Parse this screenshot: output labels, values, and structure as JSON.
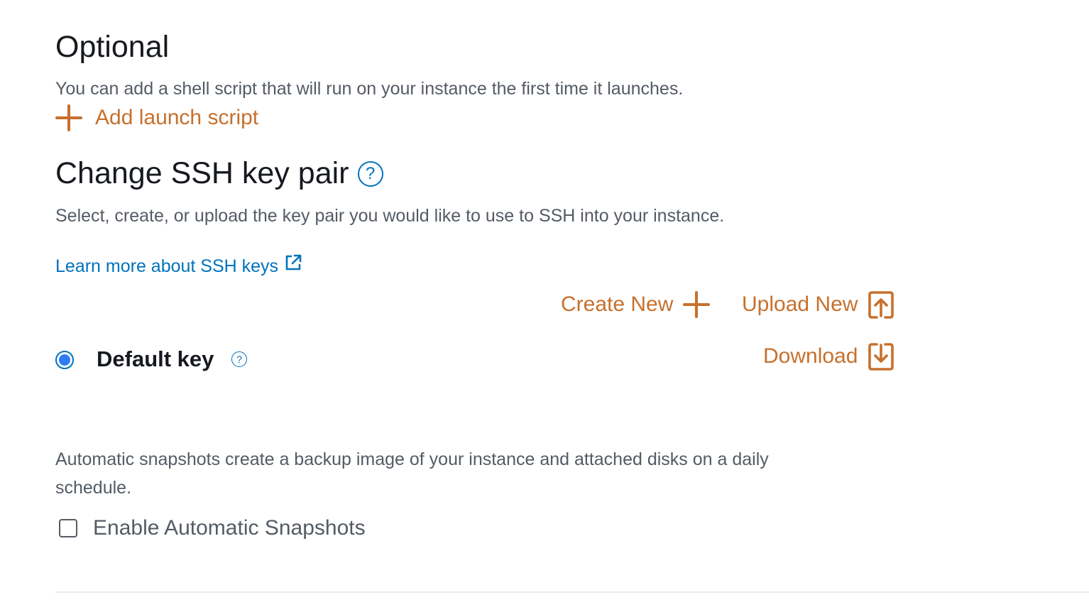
{
  "optional": {
    "heading": "Optional",
    "description": "You can add a shell script that will run on your instance the first time it launches.",
    "add_script_label": "Add launch script"
  },
  "ssh": {
    "heading": "Change SSH key pair",
    "help_glyph": "?",
    "description": "Select, create, or upload the key pair you would like to use to SSH into your instance.",
    "learn_more_label": "Learn more about SSH keys",
    "create_new_label": "Create New",
    "upload_new_label": "Upload New",
    "download_label": "Download",
    "selected_key_label": "Default key",
    "selected_key_help_glyph": "?"
  },
  "snapshots": {
    "description_line1": "Automatic snapshots create a backup image of your instance and attached disks on a daily",
    "description_line2": "schedule.",
    "checkbox_label": "Enable Automatic Snapshots",
    "checked": false
  },
  "icons": {
    "add_script": "plus-icon",
    "ssh_help": "help-circle-icon",
    "learn_more": "external-link-icon",
    "create_new": "plus-icon",
    "upload_new": "upload-icon",
    "download": "download-icon"
  },
  "colors": {
    "accent_orange": "#c7702c",
    "link_blue": "#0073bb",
    "radio_blue": "#2f7bf5",
    "heading": "#16191f",
    "body_text": "#545b64"
  }
}
